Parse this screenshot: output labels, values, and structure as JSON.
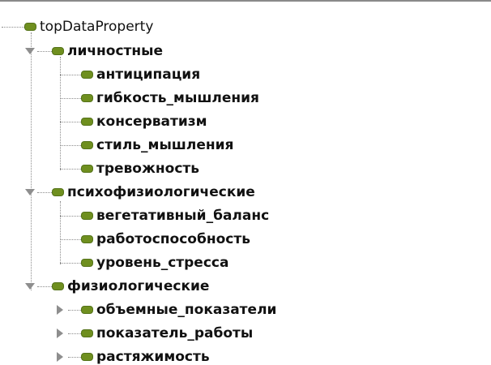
{
  "tree": {
    "root": {
      "label": "topDataProperty"
    },
    "groups": [
      {
        "label": "личностные",
        "expanded": true,
        "children": [
          "антиципация",
          "гибкость_мышления",
          "консерватизм",
          "стиль_мышления",
          "тревожность"
        ]
      },
      {
        "label": "психофизиологические",
        "expanded": true,
        "children": [
          "вегетативный_баланс",
          "работоспособность",
          "уровень_стресса"
        ]
      },
      {
        "label": "физиологические",
        "expanded": true,
        "children": [
          "объемные_показатели",
          "показатель_работы",
          "растяжимость"
        ],
        "children_collapsed": [
          true,
          true,
          true
        ]
      }
    ]
  },
  "colors": {
    "node_icon": "#6f8f1f",
    "connector": "#8c8c8c",
    "toggle": "#8e8e8e"
  },
  "icons": {
    "node": "green-pill-icon",
    "expanded": "triangle-down-icon",
    "collapsed": "triangle-right-icon"
  }
}
